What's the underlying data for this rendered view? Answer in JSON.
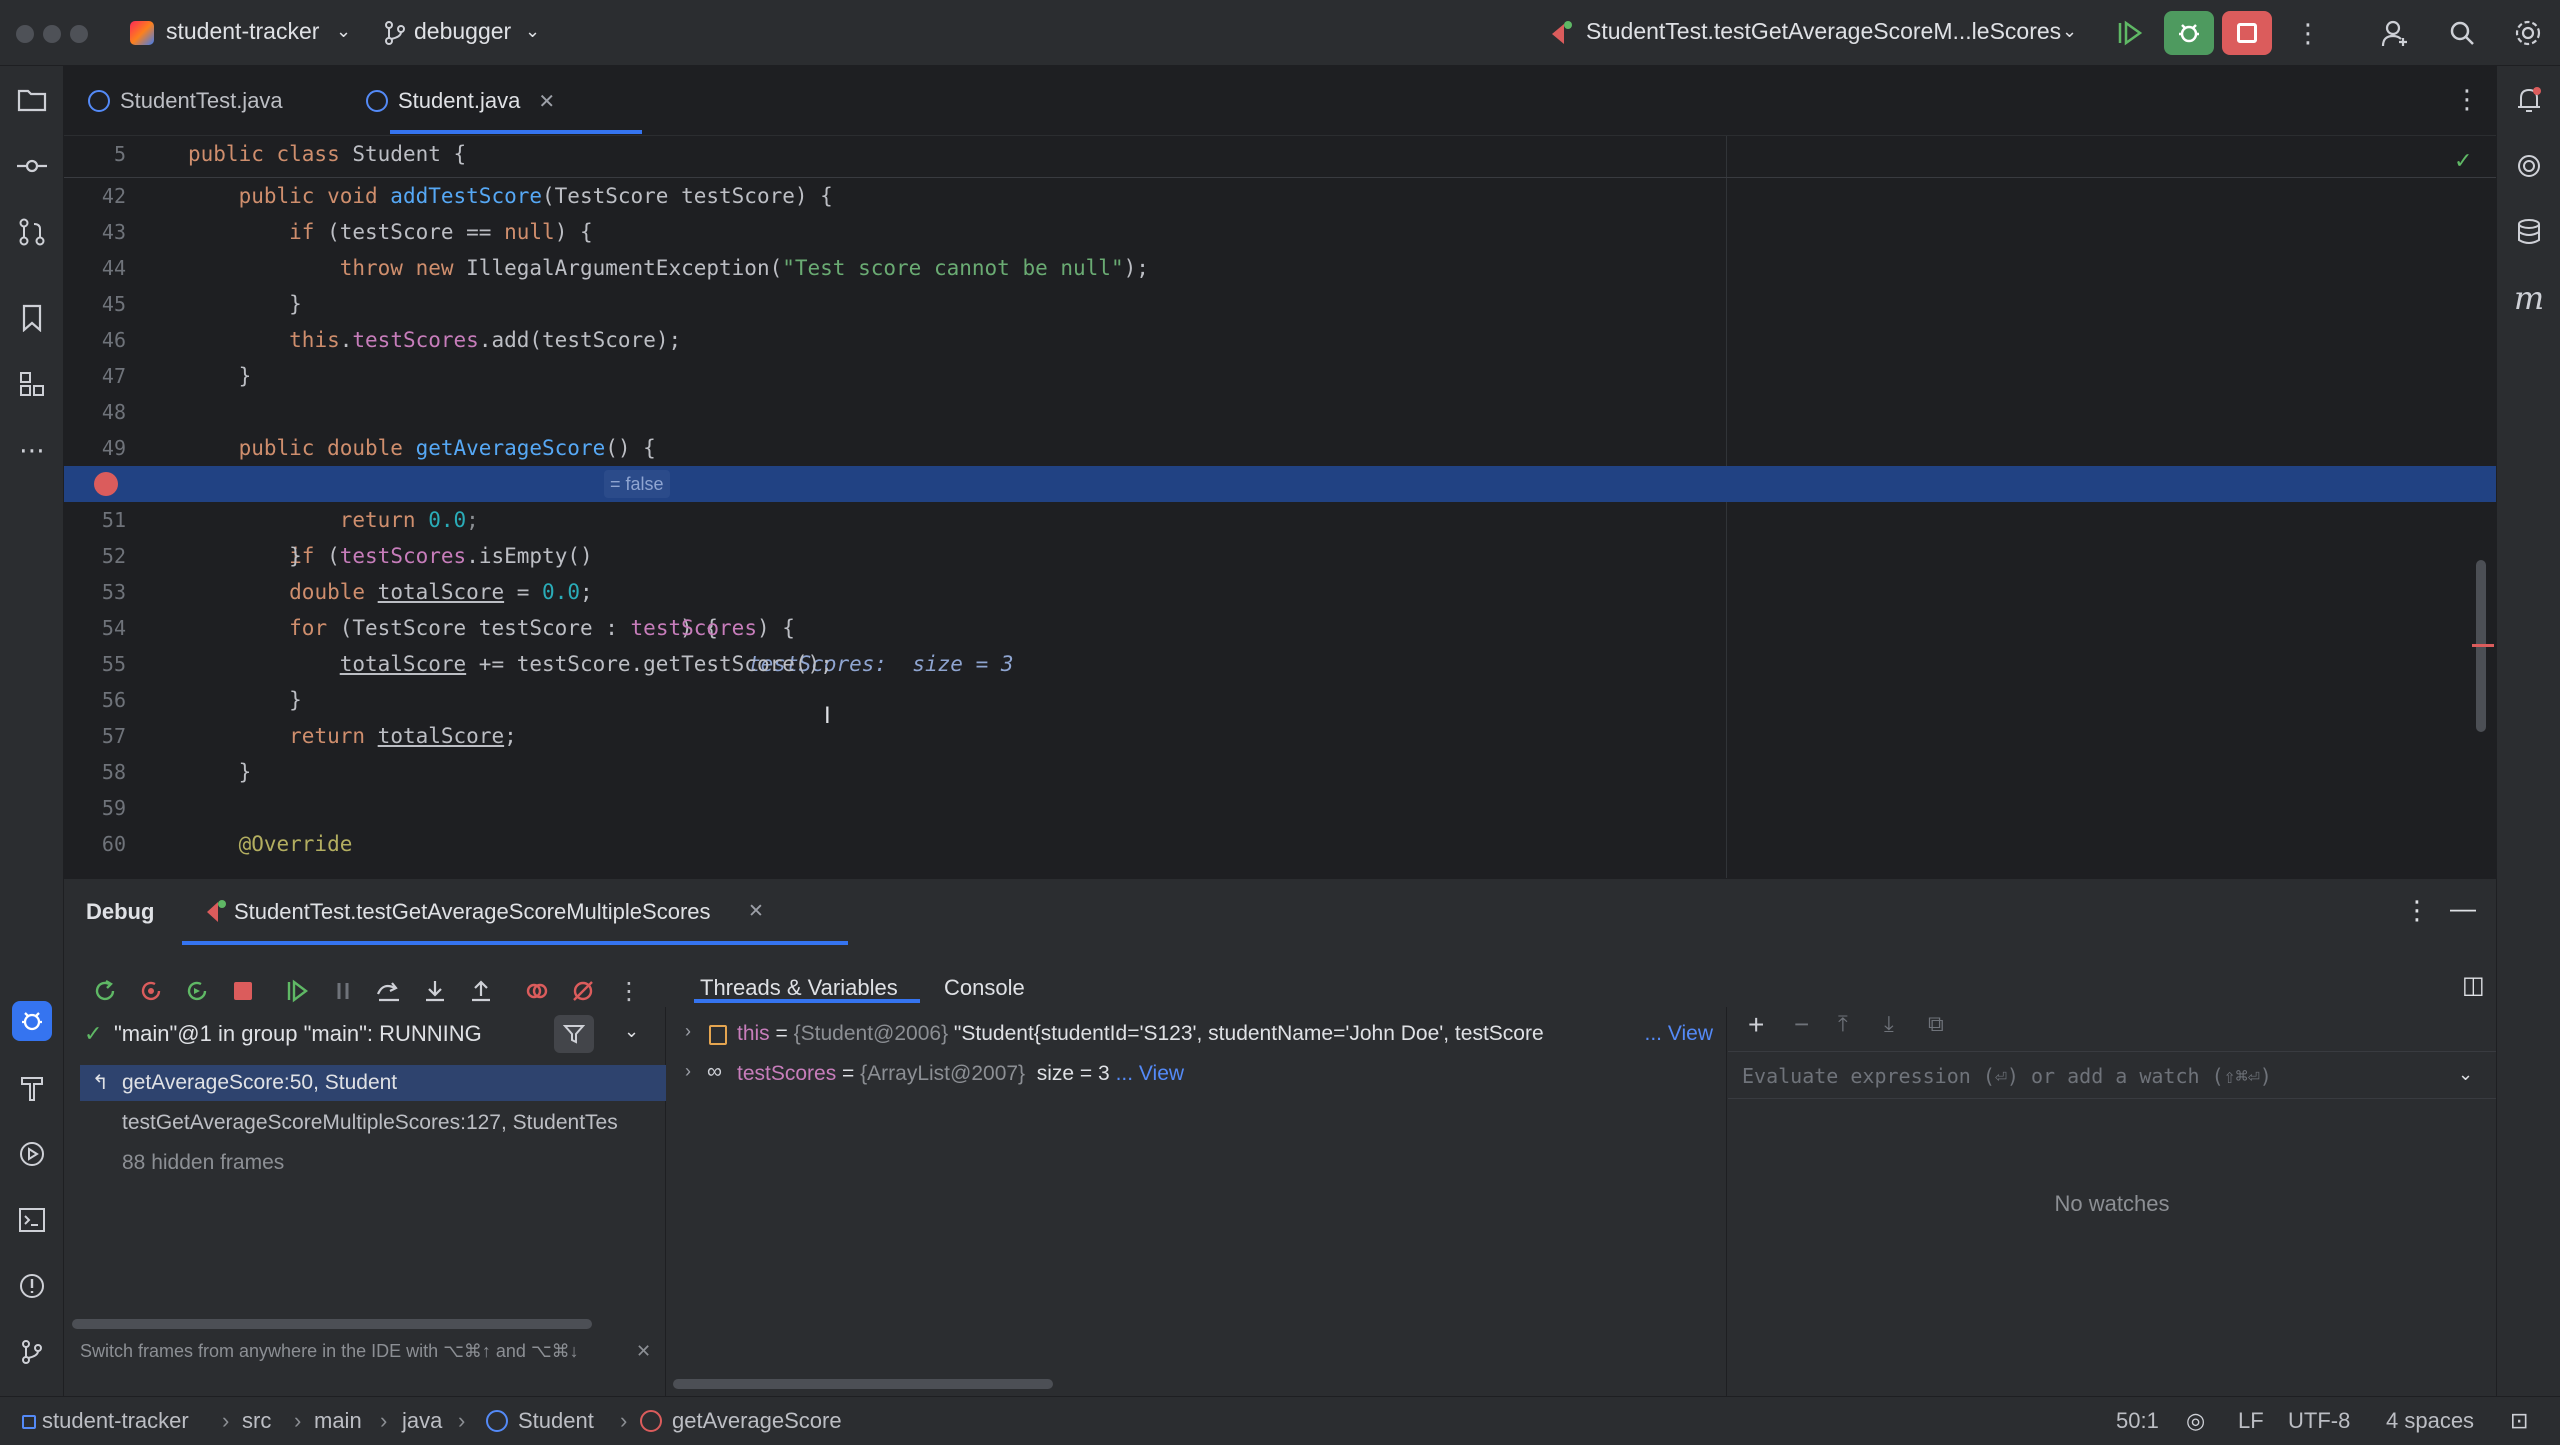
{
  "titlebar": {
    "project": "student-tracker",
    "branch": "debugger",
    "run_config": "StudentTest.testGetAverageScoreM...leScores"
  },
  "tabs": [
    {
      "label": "StudentTest.java",
      "active": false
    },
    {
      "label": "Student.java",
      "active": true
    }
  ],
  "editor": {
    "lines": [
      {
        "n": "5",
        "text": "public class Student {"
      },
      {
        "n": "42",
        "text": "    public void addTestScore(TestScore testScore) {"
      },
      {
        "n": "43",
        "text": "        if (testScore == null) {"
      },
      {
        "n": "44",
        "text": "            throw new IllegalArgumentException(\"Test score cannot be null\");"
      },
      {
        "n": "45",
        "text": "        }"
      },
      {
        "n": "46",
        "text": "        this.testScores.add(testScore);"
      },
      {
        "n": "47",
        "text": "    }"
      },
      {
        "n": "48",
        "text": ""
      },
      {
        "n": "49",
        "text": "    public double getAverageScore() {"
      },
      {
        "n": "50",
        "text": "        if (testScores.isEmpty()"
      },
      {
        "n": "51",
        "text": "            return 0.0;"
      },
      {
        "n": "52",
        "text": "        }"
      },
      {
        "n": "53",
        "text": "        double totalScore = 0.0;"
      },
      {
        "n": "54",
        "text": "        for (TestScore testScore : testScores) {"
      },
      {
        "n": "55",
        "text": "            totalScore += testScore.getTestScore();"
      },
      {
        "n": "56",
        "text": "        }"
      },
      {
        "n": "57",
        "text": "        return totalScore;"
      },
      {
        "n": "58",
        "text": "    }"
      },
      {
        "n": "59",
        "text": ""
      },
      {
        "n": "60",
        "text": "    @Override"
      }
    ],
    "inline_hint": "= false",
    "line50_tail": ") {",
    "inline_value": "testScores:  size = 3"
  },
  "debug": {
    "title": "Debug",
    "session": "StudentTest.testGetAverageScoreMultipleScores",
    "tab_threads": "Threads & Variables",
    "tab_console": "Console",
    "thread": "\"main\"@1 in group \"main\": RUNNING",
    "frames": [
      "getAverageScore:50, Student",
      "testGetAverageScoreMultipleScores:127, StudentTes"
    ],
    "hidden_frames": "88 hidden frames",
    "hint": "Switch frames from anywhere in the IDE with ⌥⌘↑ and ⌥⌘↓",
    "var1_name": "this",
    "var1_eq": " = ",
    "var1_type": "{Student@2006}",
    "var1_value": " \"Student{studentId='S123', studentName='John Doe', testScore",
    "var1_link": "... View",
    "var2_name": "testScores",
    "var2_eq": " = ",
    "var2_type": "{ArrayList@2007}",
    "var2_value": "  size = 3",
    "var2_link": "... View",
    "watch_placeholder": "Evaluate expression (⏎) or add a watch (⇧⌘⏎)",
    "no_watches": "No watches"
  },
  "statusbar": {
    "crumbs": [
      "student-tracker",
      "src",
      "main",
      "java",
      "Student",
      "getAverageScore"
    ],
    "position": "50:1",
    "line_sep": "LF",
    "encoding": "UTF-8",
    "indent": "4 spaces"
  },
  "colors": {
    "accent": "#3574f0",
    "run_green": "#4e9a5f",
    "stop_red": "#db5c5c"
  }
}
